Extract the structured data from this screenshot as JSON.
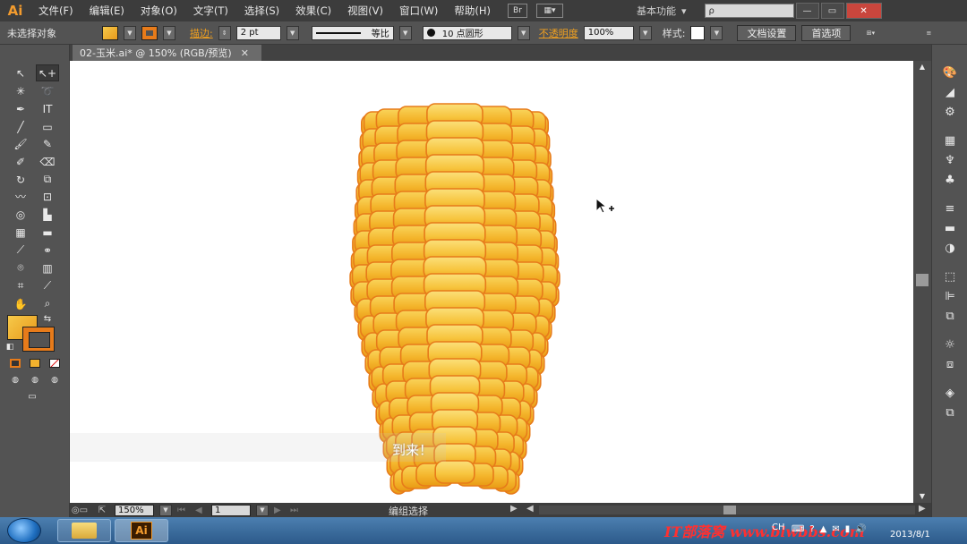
{
  "app": {
    "logo": "Ai"
  },
  "menu": {
    "items": [
      "文件(F)",
      "编辑(E)",
      "对象(O)",
      "文字(T)",
      "选择(S)",
      "效果(C)",
      "视图(V)",
      "窗口(W)",
      "帮助(H)"
    ],
    "br_label": "Br",
    "workspace": "基本功能",
    "workspace_arrow": "▾",
    "search_glyph": "ρ"
  },
  "window_controls": {
    "minimize": "—",
    "restore": "▭",
    "close": "✕"
  },
  "control": {
    "selection": "未选择对象",
    "stroke_label": "描边:",
    "stroke_value": "2 pt",
    "stroke_profile": "等比",
    "brush": "10 点圆形",
    "opacity_label": "不透明度",
    "opacity_value": "100%",
    "style_label": "样式:",
    "doc_setup": "文档设置",
    "preferences": "首选项"
  },
  "document": {
    "tab_title": "02-玉米.ai* @ 150% (RGB/预览)",
    "close": "✕"
  },
  "canvas": {
    "overlay_caption": "到来！"
  },
  "status": {
    "zoom": "150%",
    "page": "1",
    "tool_text": "编组选择"
  },
  "taskbar": {
    "watermark": "IT部落窝 www.blwbbs.com",
    "lang": "CH",
    "date": "2013/8/1"
  },
  "colors": {
    "fill": "#f2b22e",
    "stroke": "#e77b1a",
    "accent": "#f0a020"
  }
}
